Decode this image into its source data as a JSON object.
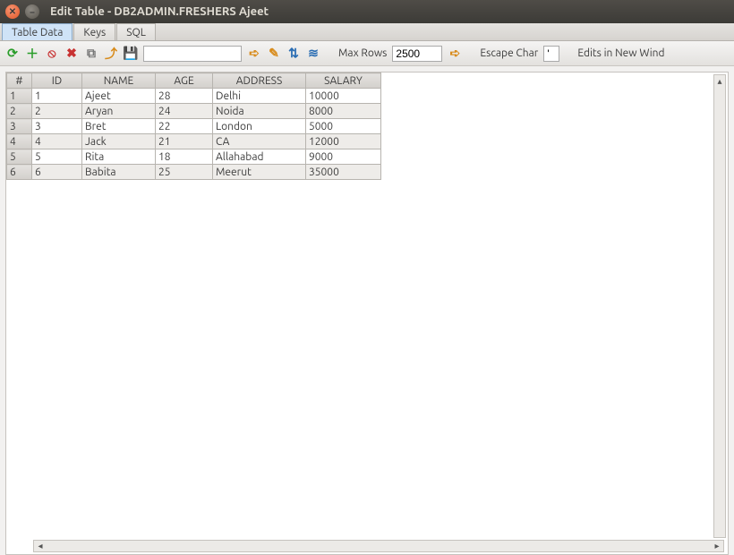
{
  "window": {
    "title": "Edit Table - DB2ADMIN.FRESHERS Ajeet"
  },
  "tabs": [
    {
      "label": "Table Data",
      "active": true
    },
    {
      "label": "Keys",
      "active": false
    },
    {
      "label": "SQL",
      "active": false
    }
  ],
  "toolbar": {
    "search_value": "",
    "max_rows_label": "Max Rows",
    "max_rows_value": "2500",
    "escape_char_label": "Escape Char",
    "escape_char_value": "'",
    "more_label": "Edits in New Wind"
  },
  "columns": [
    {
      "key": "rownum",
      "label": "#"
    },
    {
      "key": "id",
      "label": "ID"
    },
    {
      "key": "name",
      "label": "NAME"
    },
    {
      "key": "age",
      "label": "AGE"
    },
    {
      "key": "addr",
      "label": "ADDRESS"
    },
    {
      "key": "sal",
      "label": "SALARY"
    }
  ],
  "rows": [
    {
      "rownum": "1",
      "id": "1",
      "name": "Ajeet",
      "age": "28",
      "addr": "Delhi",
      "sal": "10000"
    },
    {
      "rownum": "2",
      "id": "2",
      "name": "Aryan",
      "age": "24",
      "addr": "Noida",
      "sal": "8000"
    },
    {
      "rownum": "3",
      "id": "3",
      "name": "Bret",
      "age": "22",
      "addr": "London",
      "sal": "5000"
    },
    {
      "rownum": "4",
      "id": "4",
      "name": "Jack",
      "age": "21",
      "addr": "CA",
      "sal": "12000"
    },
    {
      "rownum": "5",
      "id": "5",
      "name": "Rita",
      "age": "18",
      "addr": "Allahabad",
      "sal": "9000"
    },
    {
      "rownum": "6",
      "id": "6",
      "name": "Babita",
      "age": "25",
      "addr": "Meerut",
      "sal": "35000"
    }
  ]
}
